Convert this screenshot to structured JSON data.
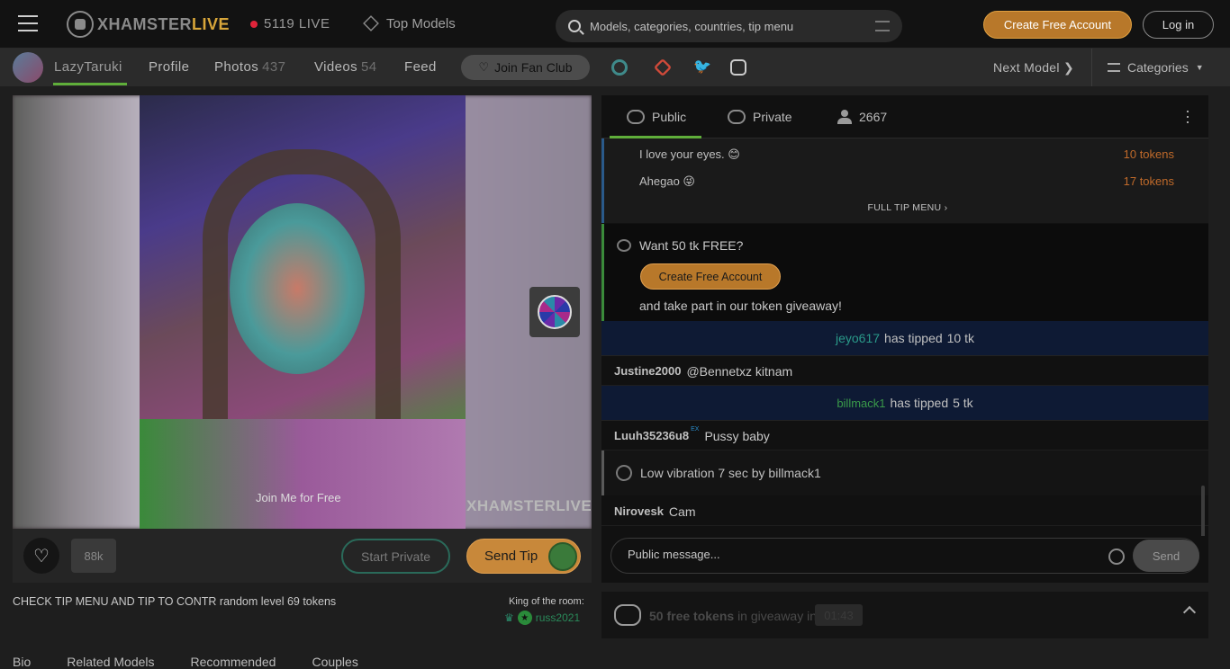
{
  "header": {
    "brand_x": "XHAMSTER",
    "brand_live": "LIVE",
    "live_count": "5119 LIVE",
    "top_models": "Top Models",
    "search_placeholder": "Models, categories, countries, tip menu",
    "create_account": "Create Free Account",
    "login": "Log in"
  },
  "subnav": {
    "model_name": "LazyTaruki",
    "profile": "Profile",
    "photos": "Photos",
    "photos_count": "437",
    "videos": "Videos",
    "videos_count": "54",
    "feed": "Feed",
    "fan_club": "Join Fan Club",
    "next_model": "Next Model",
    "categories": "Categories"
  },
  "player": {
    "join_watermark": "Join Me for Free",
    "brand_watermark": "XHAMSTERLIVE",
    "like_count": "88k",
    "start_private": "Start Private",
    "send_tip": "Send Tip"
  },
  "topic": "CHECK TIP MENU AND TIP TO CONTR random level 69 tokens",
  "king": {
    "label": "King of the room:",
    "user": "russ2021"
  },
  "bottom_tabs": [
    "Bio",
    "Related Models",
    "Recommended",
    "Couples"
  ],
  "chat": {
    "tab_public": "Public",
    "tab_private": "Private",
    "viewers": "2667",
    "tip_menu": [
      {
        "item": "I love your eyes. 😊",
        "price": "10 tokens"
      },
      {
        "item": "Ahegao 😜",
        "price": "17 tokens"
      }
    ],
    "full_tip_menu": "FULL TIP MENU",
    "promo_title": "Want 50 tk FREE?",
    "promo_button": "Create Free Account",
    "promo_sub": "and take part in our token giveaway!",
    "messages": [
      {
        "type": "tip",
        "user": "jeyo617",
        "text": "has tipped",
        "amount": "10 tk"
      },
      {
        "type": "msg",
        "user": "Justine2000",
        "text": "@Bennetxz kitnam"
      },
      {
        "type": "tip",
        "user": "billmack1",
        "text": "has tipped",
        "amount": "5 tk"
      },
      {
        "type": "msg",
        "user": "Luuh35236u8",
        "badge": "EX",
        "text": "Pussy baby"
      },
      {
        "type": "vib",
        "text": "Low vibration 7 sec by billmack1"
      },
      {
        "type": "msg",
        "user": "Nirovesk",
        "text": "Cam"
      }
    ],
    "input_placeholder": "Public message...",
    "send": "Send"
  },
  "giveaway": {
    "bold": "50 free tokens",
    "text": "in giveaway in",
    "timer": "01:43"
  },
  "colors": {
    "accent_green": "#5fae3a",
    "brand_gold": "#d8a63a",
    "tip_orange": "#c06a2a",
    "tip_row_bg": "#0e1a34"
  }
}
